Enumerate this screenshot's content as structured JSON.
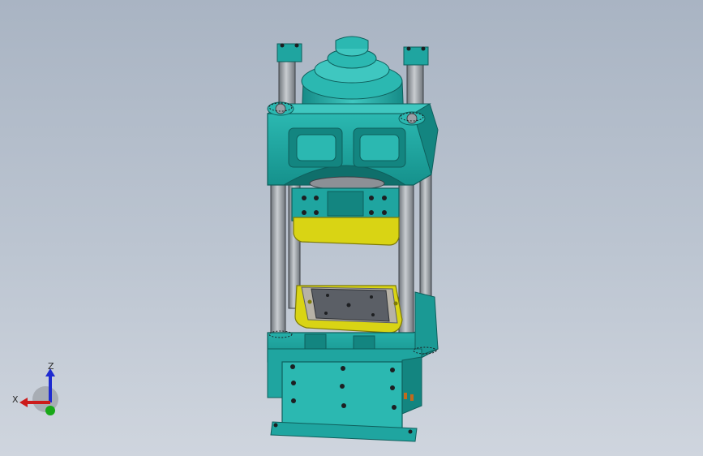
{
  "viewport": {
    "background_top": "#a9b4c3",
    "background_bottom": "#cfd5de"
  },
  "model": {
    "colors": {
      "teal": "#1fa5a0",
      "teal_light": "#3fc7c0",
      "teal_dark": "#127a76",
      "yellow": "#d9d414",
      "yellow_dark": "#a8a40c",
      "rod": "#9aa0a6",
      "plate": "#5b5f66",
      "bolt": "#1d1f22"
    }
  },
  "triad": {
    "axes": [
      {
        "name": "z",
        "label": "Z",
        "color": "#1f2bd0"
      },
      {
        "name": "x",
        "label": "X",
        "color": "#cc1b1b"
      },
      {
        "name": "y",
        "label": "",
        "color": "#18a818"
      }
    ]
  }
}
